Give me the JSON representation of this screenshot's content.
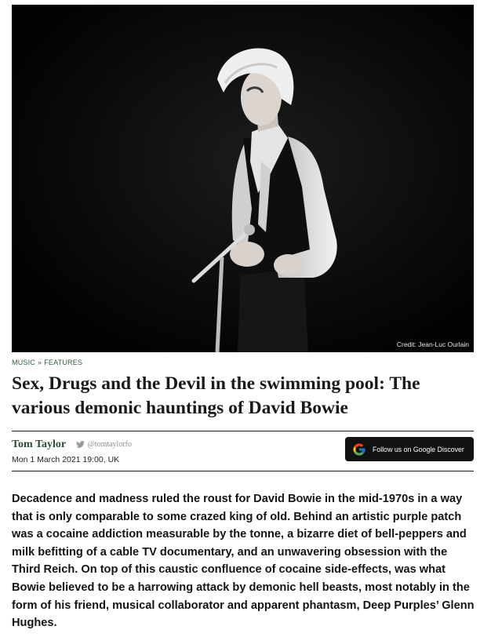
{
  "hero": {
    "credit": "Credit: Jean-Luc Ourlain"
  },
  "breadcrumb": {
    "section": "MUSIC",
    "separator": "»",
    "subsection": "FEATURES"
  },
  "article": {
    "headline": "Sex, Drugs and the Devil in the swimming pool: The various demonic hauntings of David Bowie",
    "author": "Tom Taylor",
    "twitter_handle": "@tomtaylorfo",
    "dateline": "Mon 1 March 2021 19:00, UK",
    "lede": "Decadence and madness ruled the roust for David Bowie in the mid-1970s in a way that is only comparable to some crazed king of old. Behind an artistic purple patch was a cocaine addiction measurable by the tonne, a bizarre diet of bell-peppers and milk befitting of a cable TV documentary, and an unwavering obsession with the Third Reich. On top of this caustic confluence of cocaine side-effects, was what Bowie believed to be a harrowing attack by demonic hell beasts, most notably in the form of his friend, musical collaborator and apparent phantasm, Deep Purples’ Glenn Hughes."
  },
  "follow_button": {
    "label": "Follow us on Google Discover",
    "icon": "google-g-icon"
  },
  "icons": {
    "twitter": "twitter-bird-icon"
  },
  "colors": {
    "author": "#2c4a34",
    "breadcrumb": "#2f5b3d",
    "button_bg": "#111111",
    "twitter_handle": "#8d8d8d"
  }
}
